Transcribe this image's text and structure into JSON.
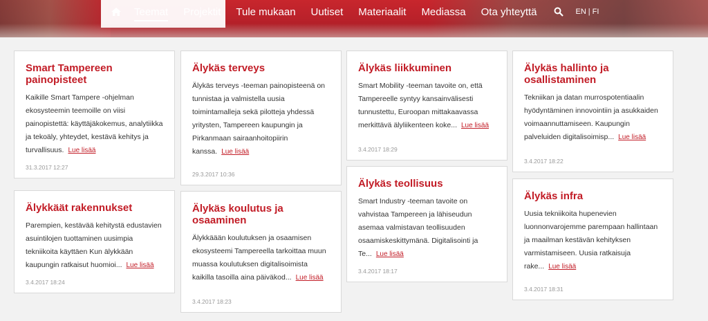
{
  "nav": {
    "items": [
      "Teemat",
      "Projektit",
      "Tule mukaan",
      "Uutiset",
      "Materiaalit",
      "Mediassa",
      "Ota yhteyttä"
    ],
    "active": "Teemat",
    "lang_en": "EN",
    "lang_sep": "|",
    "lang_fi": "FI"
  },
  "cards": [
    {
      "title": "Smart Tampereen painopisteet",
      "text": "Kaikille Smart Tampere -ohjelman ekosysteemin teemoille on viisi painopistettä: käyttäjäkokemus, analytiikka ja tekoäly, yhteydet, kestävä kehitys ja turvallisuus.",
      "more": "Lue lisää",
      "date": "31.3.2017 12:27"
    },
    {
      "title": "Älykkäät rakennukset",
      "text": "Parempien, kestävää kehitystä edustavien asuintilojen tuottaminen uusimpia tekniikoita käyttäen Kun älykkään kaupungin ratkaisut huomioi...",
      "more": "Lue lisää",
      "date": "3.4.2017 18:24"
    },
    {
      "title": "Älykäs terveys",
      "text": "Älykäs terveys -teeman painopisteenä on tunnistaa ja valmistella uusia toimintamalleja sekä pilotteja yhdessä yritysten, Tampereen kaupungin ja Pirkanmaan sairaanhoitopiirin kanssa.",
      "more": "Lue lisää",
      "date": "29.3.2017 10:36"
    },
    {
      "title": "Älykäs koulutus ja osaaminen",
      "text": "Älykkäään koulutuksen ja osaamisen ekosysteemi Tampereella tarkoittaa muun muassa koulutuksen digitalisoimista kaikilla tasoilla aina päiväkod...",
      "more": "Lue lisää",
      "date": "3.4.2017 18:23"
    },
    {
      "title": "Älykäs liikkuminen",
      "text": "Smart Mobility -teeman tavoite on, että Tampereelle syntyy kansainvälisesti tunnustettu, Euroopan mittakaavassa merkittävä älyliikenteen koke...",
      "more": "Lue lisää",
      "date": "3.4.2017 18:29"
    },
    {
      "title": "Älykäs teollisuus",
      "text": "Smart Industry -teeman tavoite on vahvistaa Tampereen ja lähiseudun asemaa valmistavan teollisuuden osaamiskeskittymänä. Digitalisointi ja Te...",
      "more": "Lue lisää",
      "date": "3.4.2017 18:17"
    },
    {
      "title": "Älykäs hallinto ja osallistaminen",
      "text": "Tekniikan ja datan murrospotentiaalin hyödyntäminen innovointiin ja asukkaiden voimaannuttamiseen. Kaupungin palveluiden digitalisoimisp...",
      "more": "Lue lisää",
      "date": "3.4.2017 18:22"
    },
    {
      "title": "Älykäs infra",
      "text": "Uusia tekniikoita hupenevien luonnonvarojemme parempaan hallintaan ja maailman kestävän kehityksen varmistamiseen. Uusia ratkaisuja rake...",
      "more": "Lue lisää",
      "date": "3.4.2017 18:31"
    }
  ],
  "colors": {
    "brand_red": "#c21c26",
    "header_red": "#b8212a",
    "page_bg": "#f2f2f2"
  }
}
